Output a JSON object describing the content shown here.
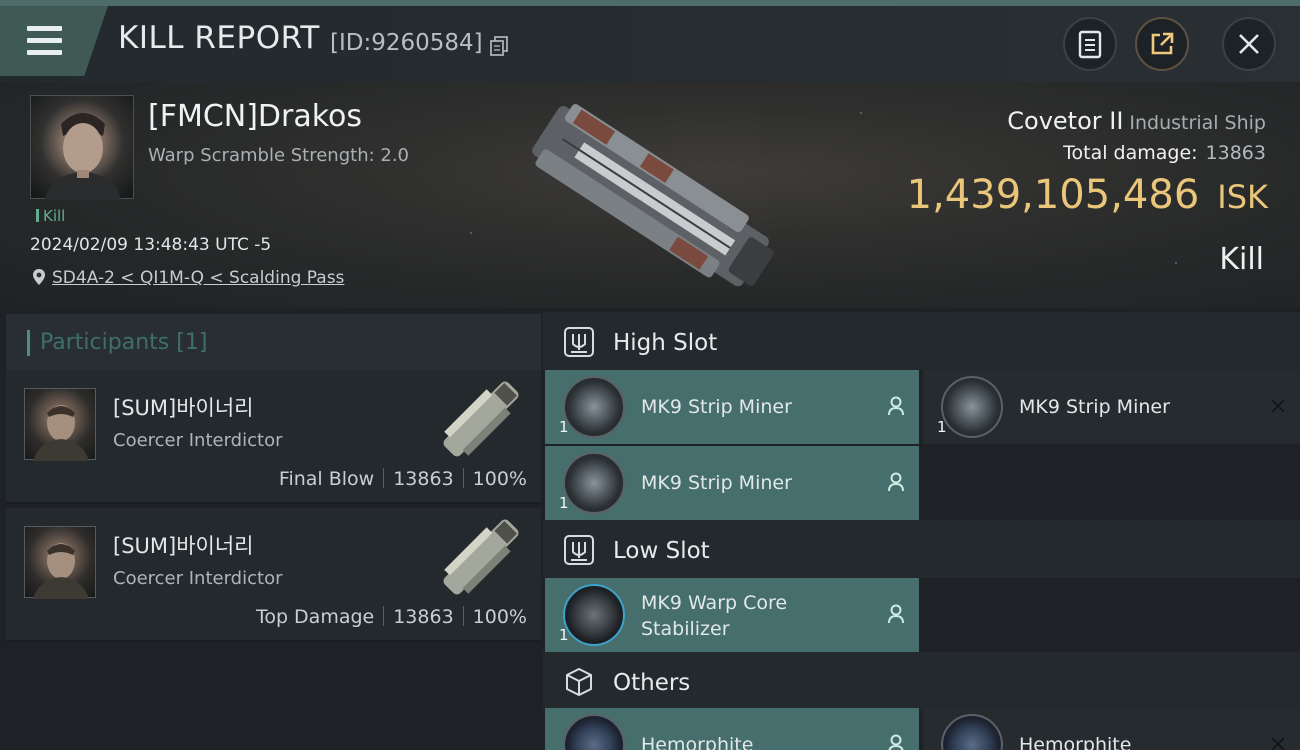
{
  "header": {
    "title": "KILL REPORT",
    "report_id": "[ID:9260584]",
    "buttons": [
      "report-icon",
      "share-icon",
      "close-icon"
    ]
  },
  "victim": {
    "name": "[FMCN]Drakos",
    "warp_scramble": "Warp Scramble Strength: 2.0",
    "kill_tag": "Kill",
    "timestamp": "2024/02/09 13:48:43 UTC -5",
    "location": "SD4A-2 < QI1M-Q < Scalding Pass",
    "ship_name": "Covetor II",
    "ship_class": "Industrial Ship",
    "total_damage_label": "Total damage:",
    "total_damage_value": "13863",
    "isk_value": "1,439,105,486",
    "isk_unit": "ISK",
    "result": "Kill"
  },
  "participants": {
    "header_label": "Participants",
    "count": "[1]",
    "items": [
      {
        "name": "[SUM]바이너리",
        "ship": "Coercer Interdictor",
        "role": "Final Blow",
        "damage": "13863",
        "percent": "100%"
      },
      {
        "name": "[SUM]바이너리",
        "ship": "Coercer Interdictor",
        "role": "Top Damage",
        "damage": "13863",
        "percent": "100%"
      }
    ]
  },
  "modules": {
    "high_slot": {
      "label": "High Slot",
      "items": [
        {
          "name": "MK9 Strip Miner",
          "qty": "1",
          "state": "fitted"
        },
        {
          "name": "MK9 Strip Miner",
          "qty": "1",
          "state": "destroyed"
        },
        {
          "name": "MK9 Strip Miner",
          "qty": "1",
          "state": "fitted"
        }
      ]
    },
    "low_slot": {
      "label": "Low Slot",
      "items": [
        {
          "name_line1": "MK9 Warp Core",
          "name_line2": "Stabilizer",
          "qty": "1",
          "state": "fitted"
        }
      ]
    },
    "others": {
      "label": "Others",
      "items": [
        {
          "name": "Hemorphite",
          "state": "fitted"
        },
        {
          "name": "Hemorphite",
          "state": "destroyed"
        }
      ]
    }
  },
  "colors": {
    "accent_teal": "#456e6c",
    "isk_gold": "#e9c67a",
    "kill_green": "#5fae8f"
  }
}
